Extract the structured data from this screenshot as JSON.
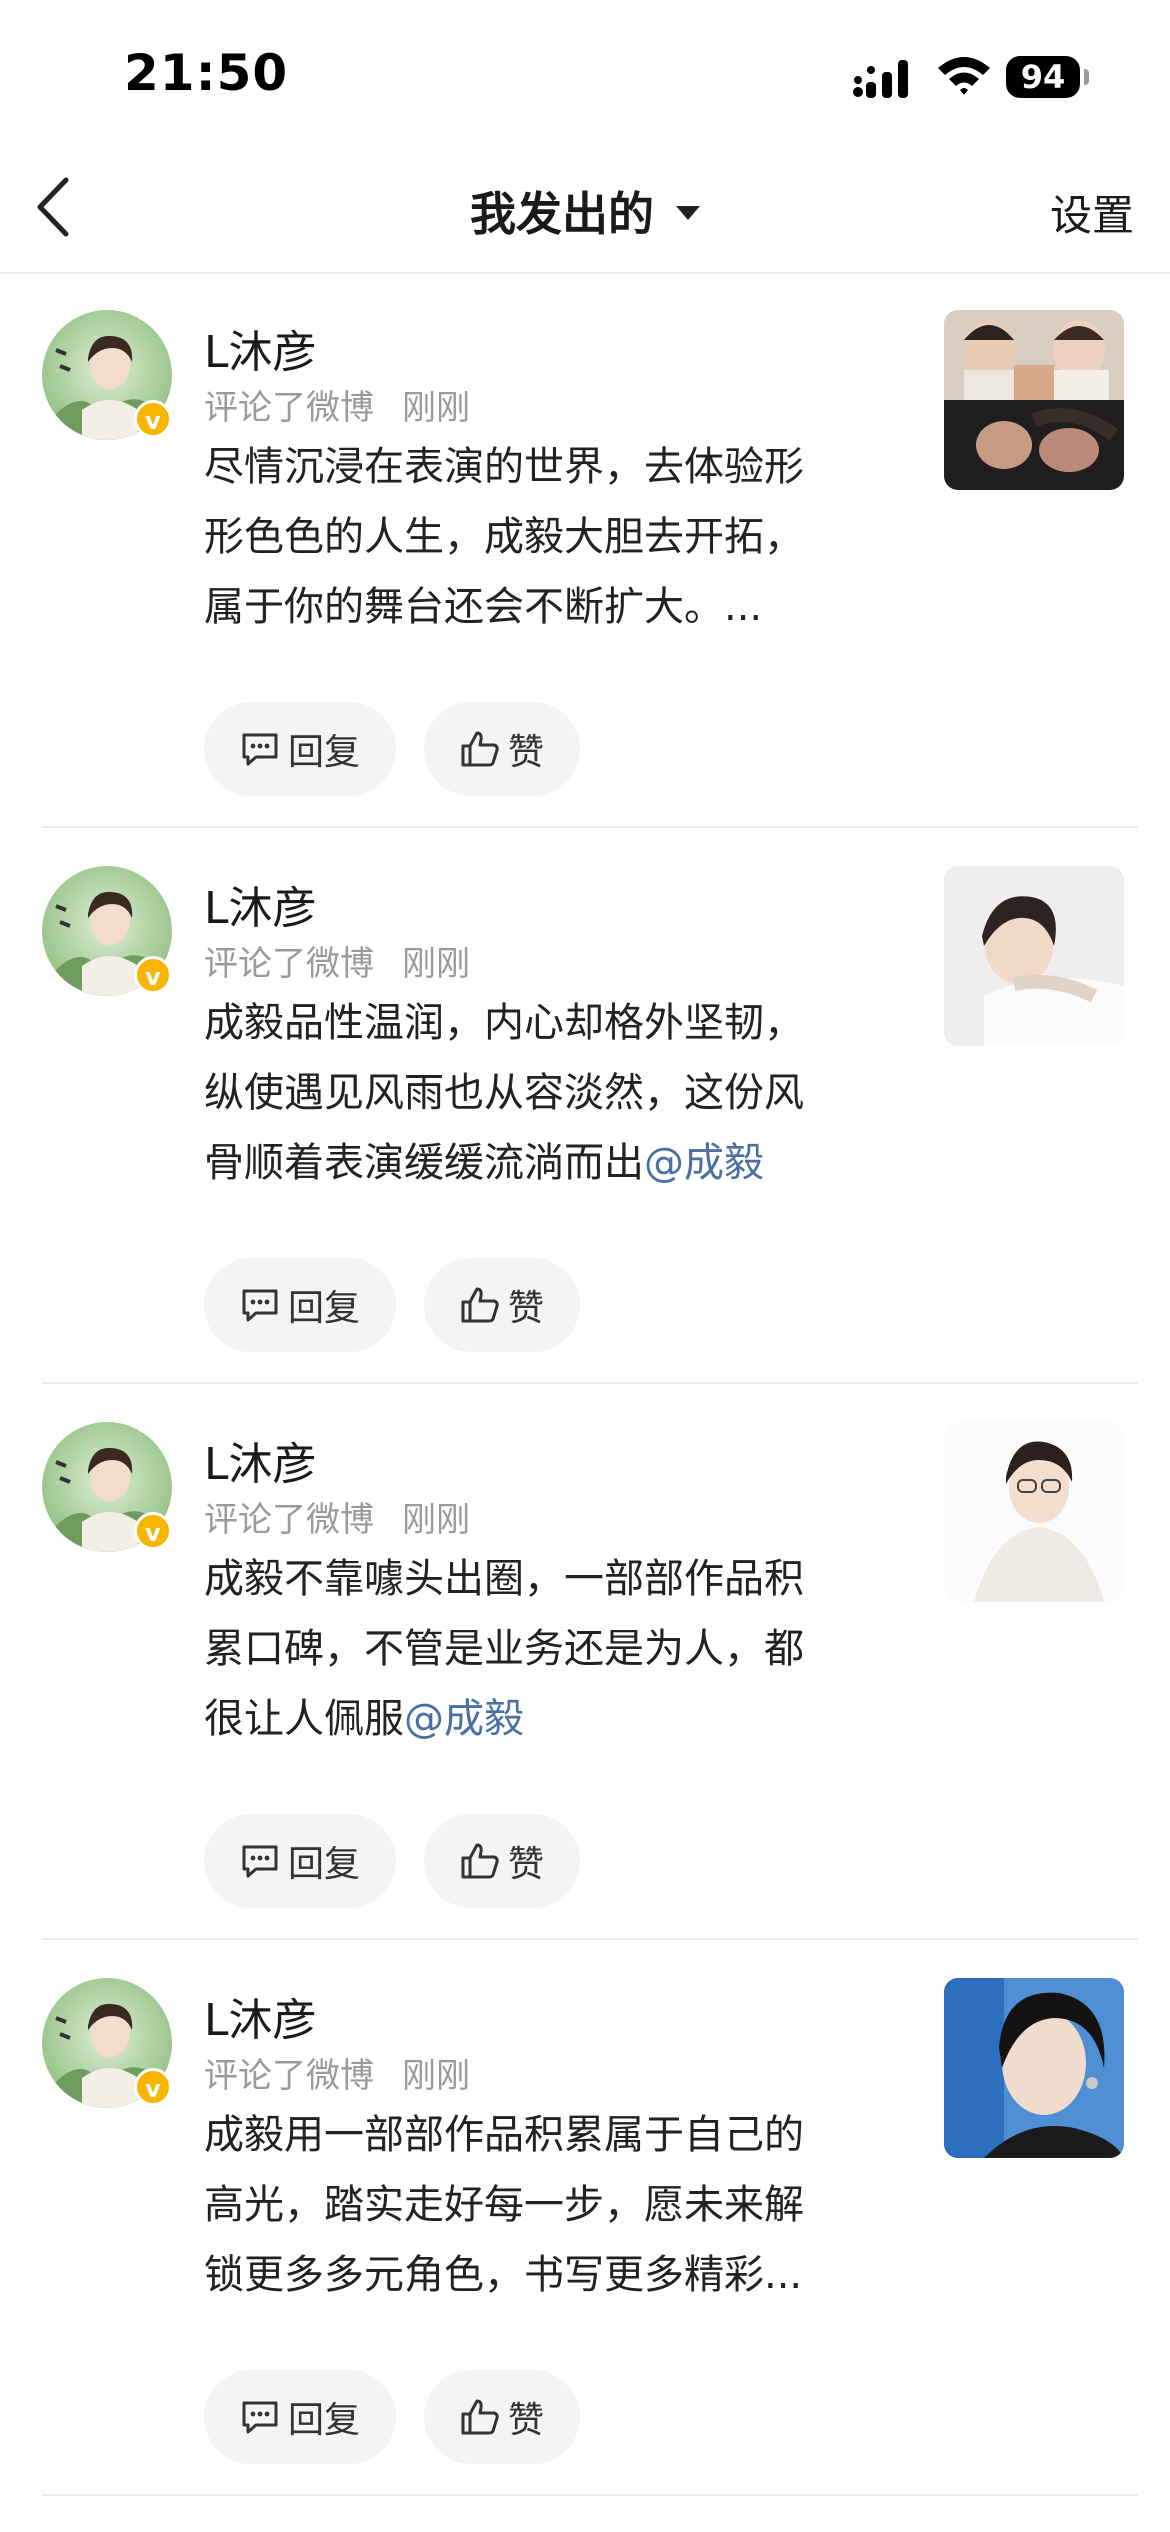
{
  "status": {
    "time": "21:50",
    "battery": "94"
  },
  "nav": {
    "title": "我发出的",
    "settings": "设置"
  },
  "actions": {
    "reply": "回复",
    "like": "赞"
  },
  "items": [
    {
      "username": "L沐彦",
      "action": "评论了微博",
      "time": "刚刚",
      "lines": [
        "尽情沉浸在表演的世界，去体验形",
        "形色色的人生，成毅大胆去开拓，",
        "属于你的舞台还会不断扩大。..."
      ],
      "last_line_text": "属于你的舞台还会不断扩大。...",
      "mention": ""
    },
    {
      "username": "L沐彦",
      "action": "评论了微博",
      "time": "刚刚",
      "lines": [
        "成毅品性温润，内心却格外坚韧，",
        "纵使遇见风雨也从容淡然，这份风"
      ],
      "last_line_text": "骨顺着表演缓缓流淌而出",
      "mention": "@成毅"
    },
    {
      "username": "L沐彦",
      "action": "评论了微博",
      "time": "刚刚",
      "lines": [
        "成毅不靠噱头出圈，一部部作品积",
        "累口碑，不管是业务还是为人，都"
      ],
      "last_line_text": "很让人佩服",
      "mention": "@成毅"
    },
    {
      "username": "L沐彦",
      "action": "评论了微博",
      "time": "刚刚",
      "lines": [
        "成毅用一部部作品积累属于自己的",
        "高光，踏实走好每一步，愿未来解"
      ],
      "last_line_text": "锁更多多元角色，书写更多精彩...",
      "mention": ""
    }
  ],
  "colors": {
    "badge": "#f7b500",
    "mention": "#4b6ea3",
    "meta": "#9a9a9a",
    "button_bg": "#f4f4f4"
  },
  "badge_glyph": "v"
}
